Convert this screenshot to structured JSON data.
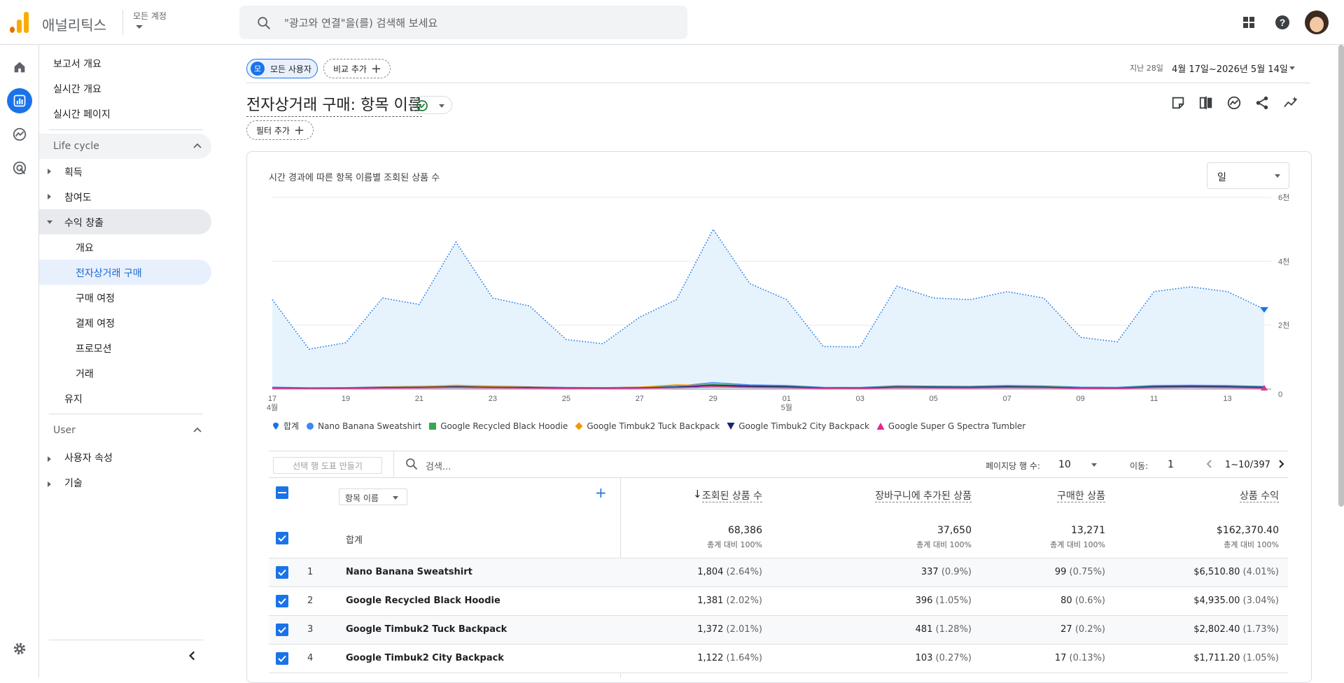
{
  "app": {
    "name": "애널리틱스",
    "account_label": "모든 계정"
  },
  "search": {
    "placeholder": "\"광고와 연결\"을(를) 검색해 보세요"
  },
  "nav": {
    "report_overview": "보고서 개요",
    "realtime_overview": "실시간 개요",
    "realtime_pages": "실시간 페이지",
    "lifecycle": "Life cycle",
    "acquisition": "획득",
    "engagement": "참여도",
    "monetization": "수익 창출",
    "overview": "개요",
    "ecommerce": "전자상거래 구매",
    "purchase_journey": "구매 여정",
    "checkout_journey": "결제 여정",
    "promotions": "프로모션",
    "transactions": "거래",
    "retention": "유지",
    "user": "User",
    "user_attributes": "사용자 속성",
    "tech": "기술"
  },
  "toolbar": {
    "segment_badge": "모",
    "segment_label": "모든 사용자",
    "compare_label": "비교 추가",
    "range_prefix": "지난 28일",
    "range_value": "4월 17일~2026년 5월 14일",
    "filter_label": "필터 추가"
  },
  "page": {
    "title": "전자상거래 구매: 항목 이름"
  },
  "chart_data": {
    "type": "area",
    "title": "시간 경과에 따른 항목 이름별 조회된 상품 수",
    "granularity": "일",
    "x": [
      "17",
      "18",
      "19",
      "20",
      "21",
      "22",
      "23",
      "24",
      "25",
      "26",
      "27",
      "28",
      "29",
      "30",
      "01",
      "02",
      "03",
      "04",
      "05",
      "06",
      "07",
      "08",
      "09",
      "10",
      "11",
      "12",
      "13",
      "14"
    ],
    "x_tick_labels": [
      "17",
      "19",
      "21",
      "23",
      "25",
      "27",
      "29",
      "01",
      "03",
      "05",
      "07",
      "09",
      "11",
      "13"
    ],
    "x_sub_labels": {
      "17": "4월",
      "01": "5월"
    },
    "y_ticks": [
      "0",
      "2천",
      "4천",
      "6천"
    ],
    "ylim": [
      0,
      6000
    ],
    "series": [
      {
        "name": "합계",
        "color": "#1a73e8",
        "values": [
          2800,
          1250,
          1450,
          2850,
          2650,
          4600,
          2850,
          2600,
          1550,
          1420,
          2250,
          2800,
          5000,
          3300,
          2800,
          1330,
          1320,
          3220,
          2850,
          2800,
          3050,
          2850,
          1620,
          1480,
          3050,
          3200,
          3050,
          2500
        ]
      },
      {
        "name": "Nano Banana Sweatshirt",
        "color": "#4285f4",
        "values": [
          60,
          40,
          45,
          70,
          80,
          110,
          90,
          70,
          50,
          45,
          60,
          90,
          200,
          130,
          110,
          55,
          50,
          100,
          90,
          85,
          110,
          95,
          60,
          55,
          110,
          120,
          110,
          80
        ]
      },
      {
        "name": "Google Recycled Black Hoodie",
        "color": "#34a853",
        "values": [
          40,
          30,
          35,
          55,
          60,
          80,
          65,
          55,
          40,
          35,
          45,
          70,
          150,
          100,
          85,
          40,
          38,
          80,
          70,
          65,
          85,
          75,
          45,
          40,
          85,
          95,
          85,
          60
        ]
      },
      {
        "name": "Google Timbuk2 Tuck Backpack",
        "color": "#f29900",
        "values": [
          45,
          30,
          40,
          60,
          70,
          120,
          80,
          60,
          45,
          40,
          60,
          130,
          110,
          80,
          60,
          40,
          35,
          70,
          60,
          55,
          70,
          60,
          40,
          35,
          60,
          70,
          60,
          45
        ]
      },
      {
        "name": "Google Timbuk2 City Backpack",
        "color": "#1a237e",
        "values": [
          35,
          25,
          30,
          45,
          55,
          70,
          55,
          50,
          35,
          30,
          40,
          60,
          120,
          90,
          70,
          35,
          30,
          65,
          60,
          55,
          70,
          60,
          35,
          30,
          70,
          80,
          70,
          50
        ]
      },
      {
        "name": "Google Super G Spectra Tumbler",
        "color": "#e52592",
        "values": [
          25,
          20,
          22,
          35,
          40,
          50,
          40,
          35,
          25,
          22,
          30,
          45,
          70,
          55,
          45,
          25,
          22,
          45,
          40,
          38,
          48,
          42,
          25,
          22,
          48,
          55,
          48,
          30
        ]
      }
    ]
  },
  "table": {
    "chart_btn": "선택 행 도표 만들기",
    "search_ph": "검색...",
    "rows_per_page_label": "페이지당 행 수:",
    "rows_per_page": "10",
    "goto_label": "이동:",
    "goto_value": "1",
    "range": "1~10/397",
    "dim_label": "항목 이름",
    "headers": [
      "조회된 상품 수",
      "장바구니에 추가된 상품",
      "구매한 상품",
      "상품 수익"
    ],
    "total_label": "합계",
    "total_sub": "총계 대비 100%",
    "totals": [
      "68,386",
      "37,650",
      "13,271",
      "$162,370.40"
    ],
    "rows": [
      {
        "idx": "1",
        "name": "Nano Banana Sweatshirt",
        "v": [
          "1,804",
          "337",
          "99",
          "$6,510.80"
        ],
        "p": [
          "(2.64%)",
          "(0.9%)",
          "(0.75%)",
          "(4.01%)"
        ]
      },
      {
        "idx": "2",
        "name": "Google Recycled Black Hoodie",
        "v": [
          "1,381",
          "396",
          "80",
          "$4,935.00"
        ],
        "p": [
          "(2.02%)",
          "(1.05%)",
          "(0.6%)",
          "(3.04%)"
        ]
      },
      {
        "idx": "3",
        "name": "Google Timbuk2 Tuck Backpack",
        "v": [
          "1,372",
          "481",
          "27",
          "$2,802.40"
        ],
        "p": [
          "(2.01%)",
          "(1.28%)",
          "(0.2%)",
          "(1.73%)"
        ]
      },
      {
        "idx": "4",
        "name": "Google Timbuk2 City Backpack",
        "v": [
          "1,122",
          "103",
          "17",
          "$1,711.20"
        ],
        "p": [
          "(1.64%)",
          "(0.27%)",
          "(0.13%)",
          "(1.05%)"
        ]
      }
    ]
  }
}
